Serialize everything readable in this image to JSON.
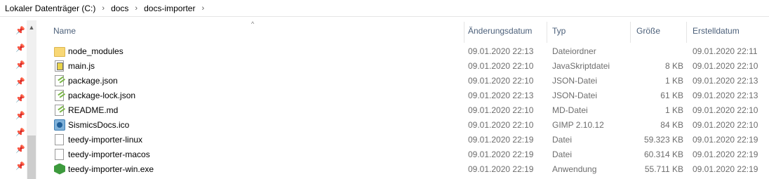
{
  "breadcrumb": {
    "items": [
      "Lokaler Datenträger (C:)",
      "docs",
      "docs-importer"
    ],
    "separator": "›"
  },
  "columns": {
    "name": "Name",
    "date": "Änderungsdatum",
    "type": "Typ",
    "size": "Größe",
    "created": "Erstelldatum"
  },
  "files": [
    {
      "name": "node_modules",
      "date": "09.01.2020 22:13",
      "type": "Dateiordner",
      "size": "",
      "created": "09.01.2020 22:11",
      "icon": "folder-icon"
    },
    {
      "name": "main.js",
      "date": "09.01.2020 22:10",
      "type": "JavaSkriptdatei",
      "size": "8 KB",
      "created": "09.01.2020 22:10",
      "icon": "javascript-file-icon"
    },
    {
      "name": "package.json",
      "date": "09.01.2020 22:10",
      "type": "JSON-Datei",
      "size": "1 KB",
      "created": "09.01.2020 22:13",
      "icon": "notepad-file-icon"
    },
    {
      "name": "package-lock.json",
      "date": "09.01.2020 22:13",
      "type": "JSON-Datei",
      "size": "61 KB",
      "created": "09.01.2020 22:13",
      "icon": "notepad-file-icon"
    },
    {
      "name": "README.md",
      "date": "09.01.2020 22:10",
      "type": "MD-Datei",
      "size": "1 KB",
      "created": "09.01.2020 22:10",
      "icon": "notepad-file-icon"
    },
    {
      "name": "SismicsDocs.ico",
      "date": "09.01.2020 22:10",
      "type": "GIMP 2.10.12",
      "size": "84 KB",
      "created": "09.01.2020 22:10",
      "icon": "image-file-icon"
    },
    {
      "name": "teedy-importer-linux",
      "date": "09.01.2020 22:19",
      "type": "Datei",
      "size": "59.323 KB",
      "created": "09.01.2020 22:19",
      "icon": "blank-file-icon"
    },
    {
      "name": "teedy-importer-macos",
      "date": "09.01.2020 22:19",
      "type": "Datei",
      "size": "60.314 KB",
      "created": "09.01.2020 22:19",
      "icon": "blank-file-icon"
    },
    {
      "name": "teedy-importer-win.exe",
      "date": "09.01.2020 22:19",
      "type": "Anwendung",
      "size": "55.711 KB",
      "created": "09.01.2020 22:19",
      "icon": "application-icon"
    }
  ]
}
